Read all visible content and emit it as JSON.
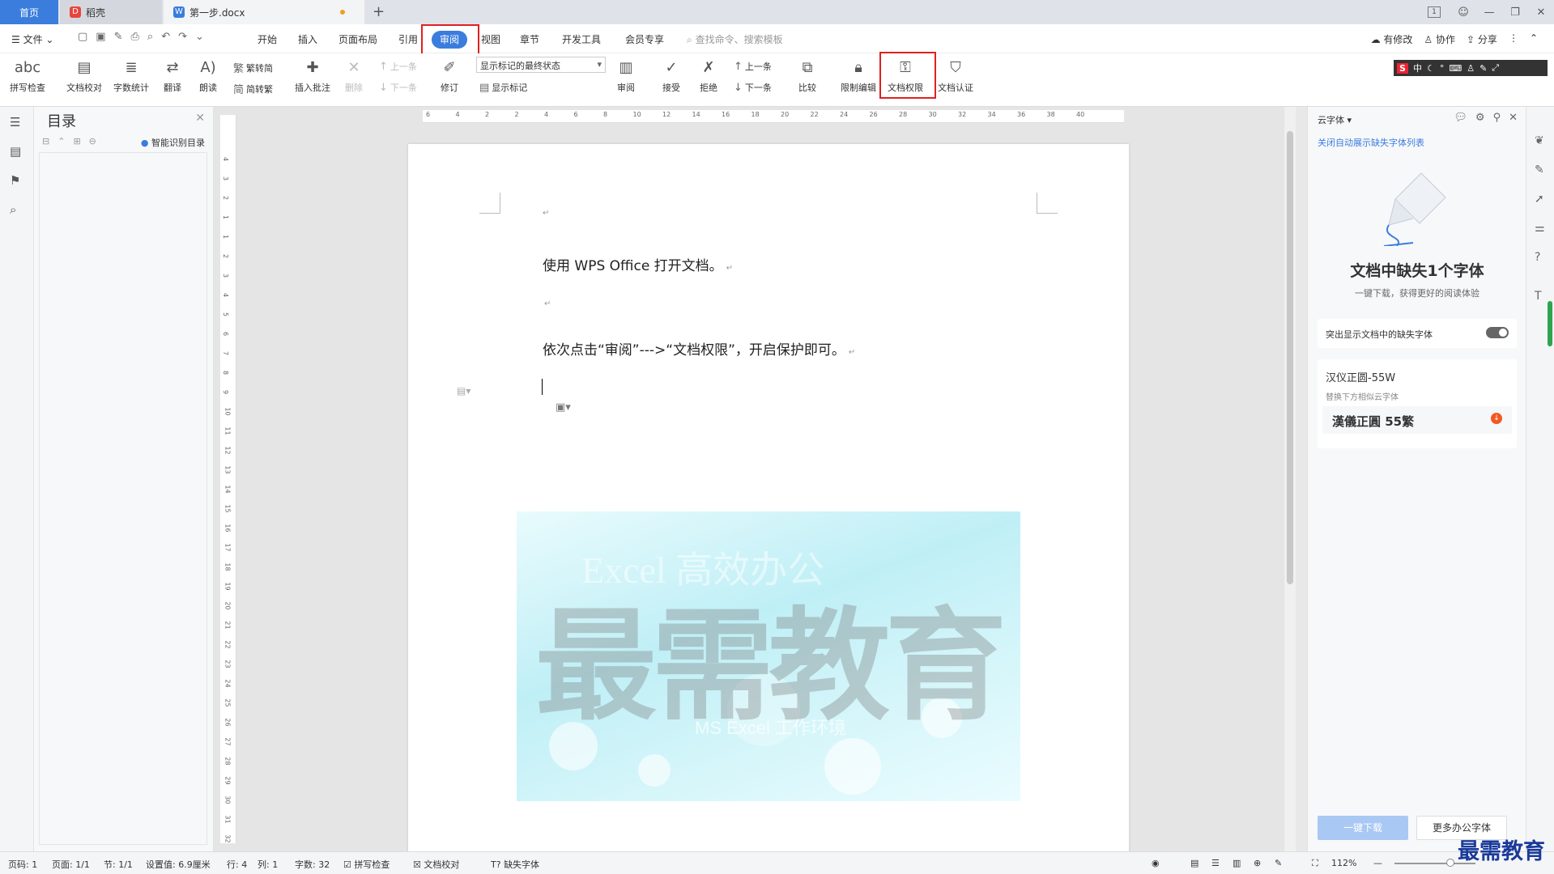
{
  "titlebar": {
    "tab_home": "首页",
    "tab_daoke": "稻壳",
    "tab_doc": "第一步.docx",
    "new_tab": "+",
    "page_indicator": "1"
  },
  "menubar": {
    "file": "文件",
    "items": [
      "开始",
      "插入",
      "页面布局",
      "引用",
      "审阅",
      "视图",
      "章节",
      "开发工具",
      "会员专享"
    ],
    "search": "查找命令、搜索模板",
    "right": [
      "有修改",
      "协作",
      "分享"
    ]
  },
  "ribbon": {
    "spell_check": "拼写检查",
    "doc_proof": "文档校对",
    "word_count": "字数统计",
    "translate": "翻译",
    "read_aloud": "朗读",
    "trad_to_simp": "繁转简",
    "simp_to_trad": "简转繁",
    "insert_comment": "插入批注",
    "delete": "删除",
    "prev_comment": "上一条",
    "next_comment": "下一条",
    "revise": "修订",
    "markup_select": "显示标记的最终状态",
    "show_markup": "显示标记",
    "review": "审阅",
    "accept": "接受",
    "reject": "拒绝",
    "prev_change": "上一条",
    "next_change": "下一条",
    "compare": "比较",
    "restrict_edit": "限制编辑",
    "doc_permission": "文档权限",
    "doc_cert": "文档认证",
    "ime": "中"
  },
  "toc": {
    "title": "目录",
    "smart": "智能识别目录"
  },
  "ruler": {
    "h_ticks": [
      "6",
      "4",
      "2",
      "2",
      "4",
      "6",
      "8",
      "10",
      "12",
      "14",
      "16",
      "18",
      "20",
      "22",
      "24",
      "26",
      "28",
      "30",
      "32",
      "34",
      "36",
      "38",
      "40"
    ],
    "v_ticks": [
      "4",
      "3",
      "2",
      "1",
      "1",
      "2",
      "3",
      "4",
      "5",
      "6",
      "7",
      "8",
      "9",
      "10",
      "11",
      "12",
      "13",
      "14",
      "15",
      "16",
      "17",
      "18",
      "19",
      "20",
      "21",
      "22",
      "23",
      "24",
      "25",
      "26",
      "27",
      "28",
      "29",
      "30",
      "31",
      "32"
    ]
  },
  "document": {
    "para1": "使用 WPS Office 打开文档。",
    "para3": "依次点击“审阅”--->“文档权限”，开启保护即可。",
    "watermark_big": "最需教育",
    "watermark_excel": "Excel 高效办公",
    "watermark_sub": "MS Excel 工作环境"
  },
  "rpanel": {
    "head": "云字体",
    "link": "关闭自动展示缺失字体列表",
    "title": "文档中缺失1个字体",
    "subtitle": "一键下载，获得更好的阅读体验",
    "toggle_label": "突出显示文档中的缺失字体",
    "font_name": "汉仪正圆-55W",
    "replace_hint": "替换下方相似云字体",
    "cloud_font": "漢儀正圓 55繁",
    "btn_download": "一键下载",
    "btn_more": "更多办公字体"
  },
  "statusbar": {
    "page_num": "页码: 1",
    "pages": "页面: 1/1",
    "section": "节: 1/1",
    "setting": "设置值: 6.9厘米",
    "row": "行: 4",
    "col": "列: 1",
    "words": "字数: 32",
    "spell": "拼写检查",
    "proof": "文档校对",
    "missing_font": "缺失字体",
    "zoom": "112%"
  },
  "brand": "最需教育",
  "colors": {
    "accent": "#3b7ddd",
    "highlight": "#e02020"
  }
}
